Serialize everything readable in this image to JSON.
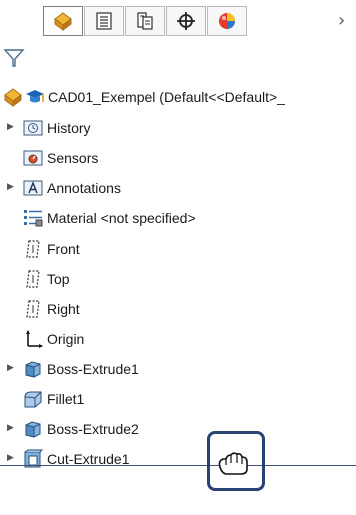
{
  "toolbar": {
    "tabs": [
      {
        "icon": "feature-manager-icon"
      },
      {
        "icon": "property-manager-icon"
      },
      {
        "icon": "configuration-manager-icon"
      },
      {
        "icon": "dimxpert-manager-icon"
      },
      {
        "icon": "display-manager-icon"
      }
    ],
    "more_label": "›"
  },
  "tree": {
    "root": {
      "label": "CAD01_Exempel  (Default<<Default>_"
    },
    "items": [
      {
        "label": "History",
        "expandable": true,
        "icon": "history-folder-icon"
      },
      {
        "label": "Sensors",
        "expandable": false,
        "icon": "sensors-folder-icon"
      },
      {
        "label": "Annotations",
        "expandable": true,
        "icon": "annotations-folder-icon"
      },
      {
        "label": "Material <not specified>",
        "expandable": false,
        "icon": "material-icon"
      },
      {
        "label": "Front",
        "expandable": false,
        "icon": "plane-icon"
      },
      {
        "label": "Top",
        "expandable": false,
        "icon": "plane-icon"
      },
      {
        "label": "Right",
        "expandable": false,
        "icon": "plane-icon"
      },
      {
        "label": "Origin",
        "expandable": false,
        "icon": "origin-icon"
      },
      {
        "label": "Boss-Extrude1",
        "expandable": true,
        "icon": "boss-extrude-icon"
      },
      {
        "label": "Fillet1",
        "expandable": false,
        "icon": "fillet-icon"
      },
      {
        "label": "Boss-Extrude2",
        "expandable": true,
        "icon": "boss-extrude-icon"
      },
      {
        "label": "Cut-Extrude1",
        "expandable": true,
        "icon": "cut-extrude-icon"
      }
    ]
  },
  "colors": {
    "rollback_bar": "#3c4f7f",
    "highlight_box": "#2b4372",
    "tab_border": "#b9b9b9"
  }
}
